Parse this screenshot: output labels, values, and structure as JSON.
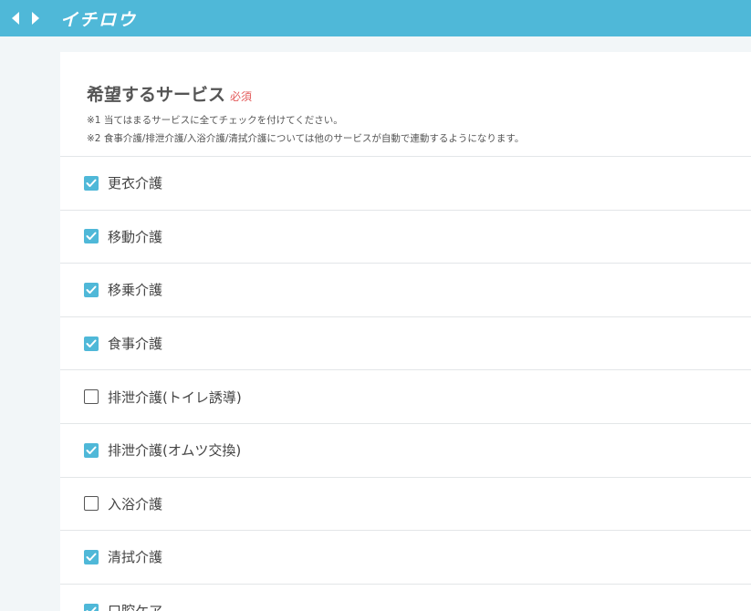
{
  "header": {
    "app_name": "イチロウ",
    "back_icon": "chevron-left-icon",
    "forward_icon": "chevron-right-icon",
    "bar_color": "#4fb8d8"
  },
  "section": {
    "title": "希望するサービス",
    "required_label": "必須",
    "notes": [
      "※1 当てはまるサービスに全てチェックを付けてください。",
      "※2 食事介護/排泄介護/入浴介護/清拭介護については他のサービスが自動で連動するようになります。"
    ]
  },
  "services": [
    {
      "label": "更衣介護",
      "checked": true
    },
    {
      "label": "移動介護",
      "checked": true
    },
    {
      "label": "移乗介護",
      "checked": true
    },
    {
      "label": "食事介護",
      "checked": true
    },
    {
      "label": "排泄介護(トイレ誘導)",
      "checked": false
    },
    {
      "label": "排泄介護(オムツ交換)",
      "checked": true
    },
    {
      "label": "入浴介護",
      "checked": false
    },
    {
      "label": "清拭介護",
      "checked": true
    },
    {
      "label": "口腔ケア",
      "checked": true
    }
  ],
  "colors": {
    "accent": "#4fb8d8",
    "required": "#e35b5b"
  }
}
